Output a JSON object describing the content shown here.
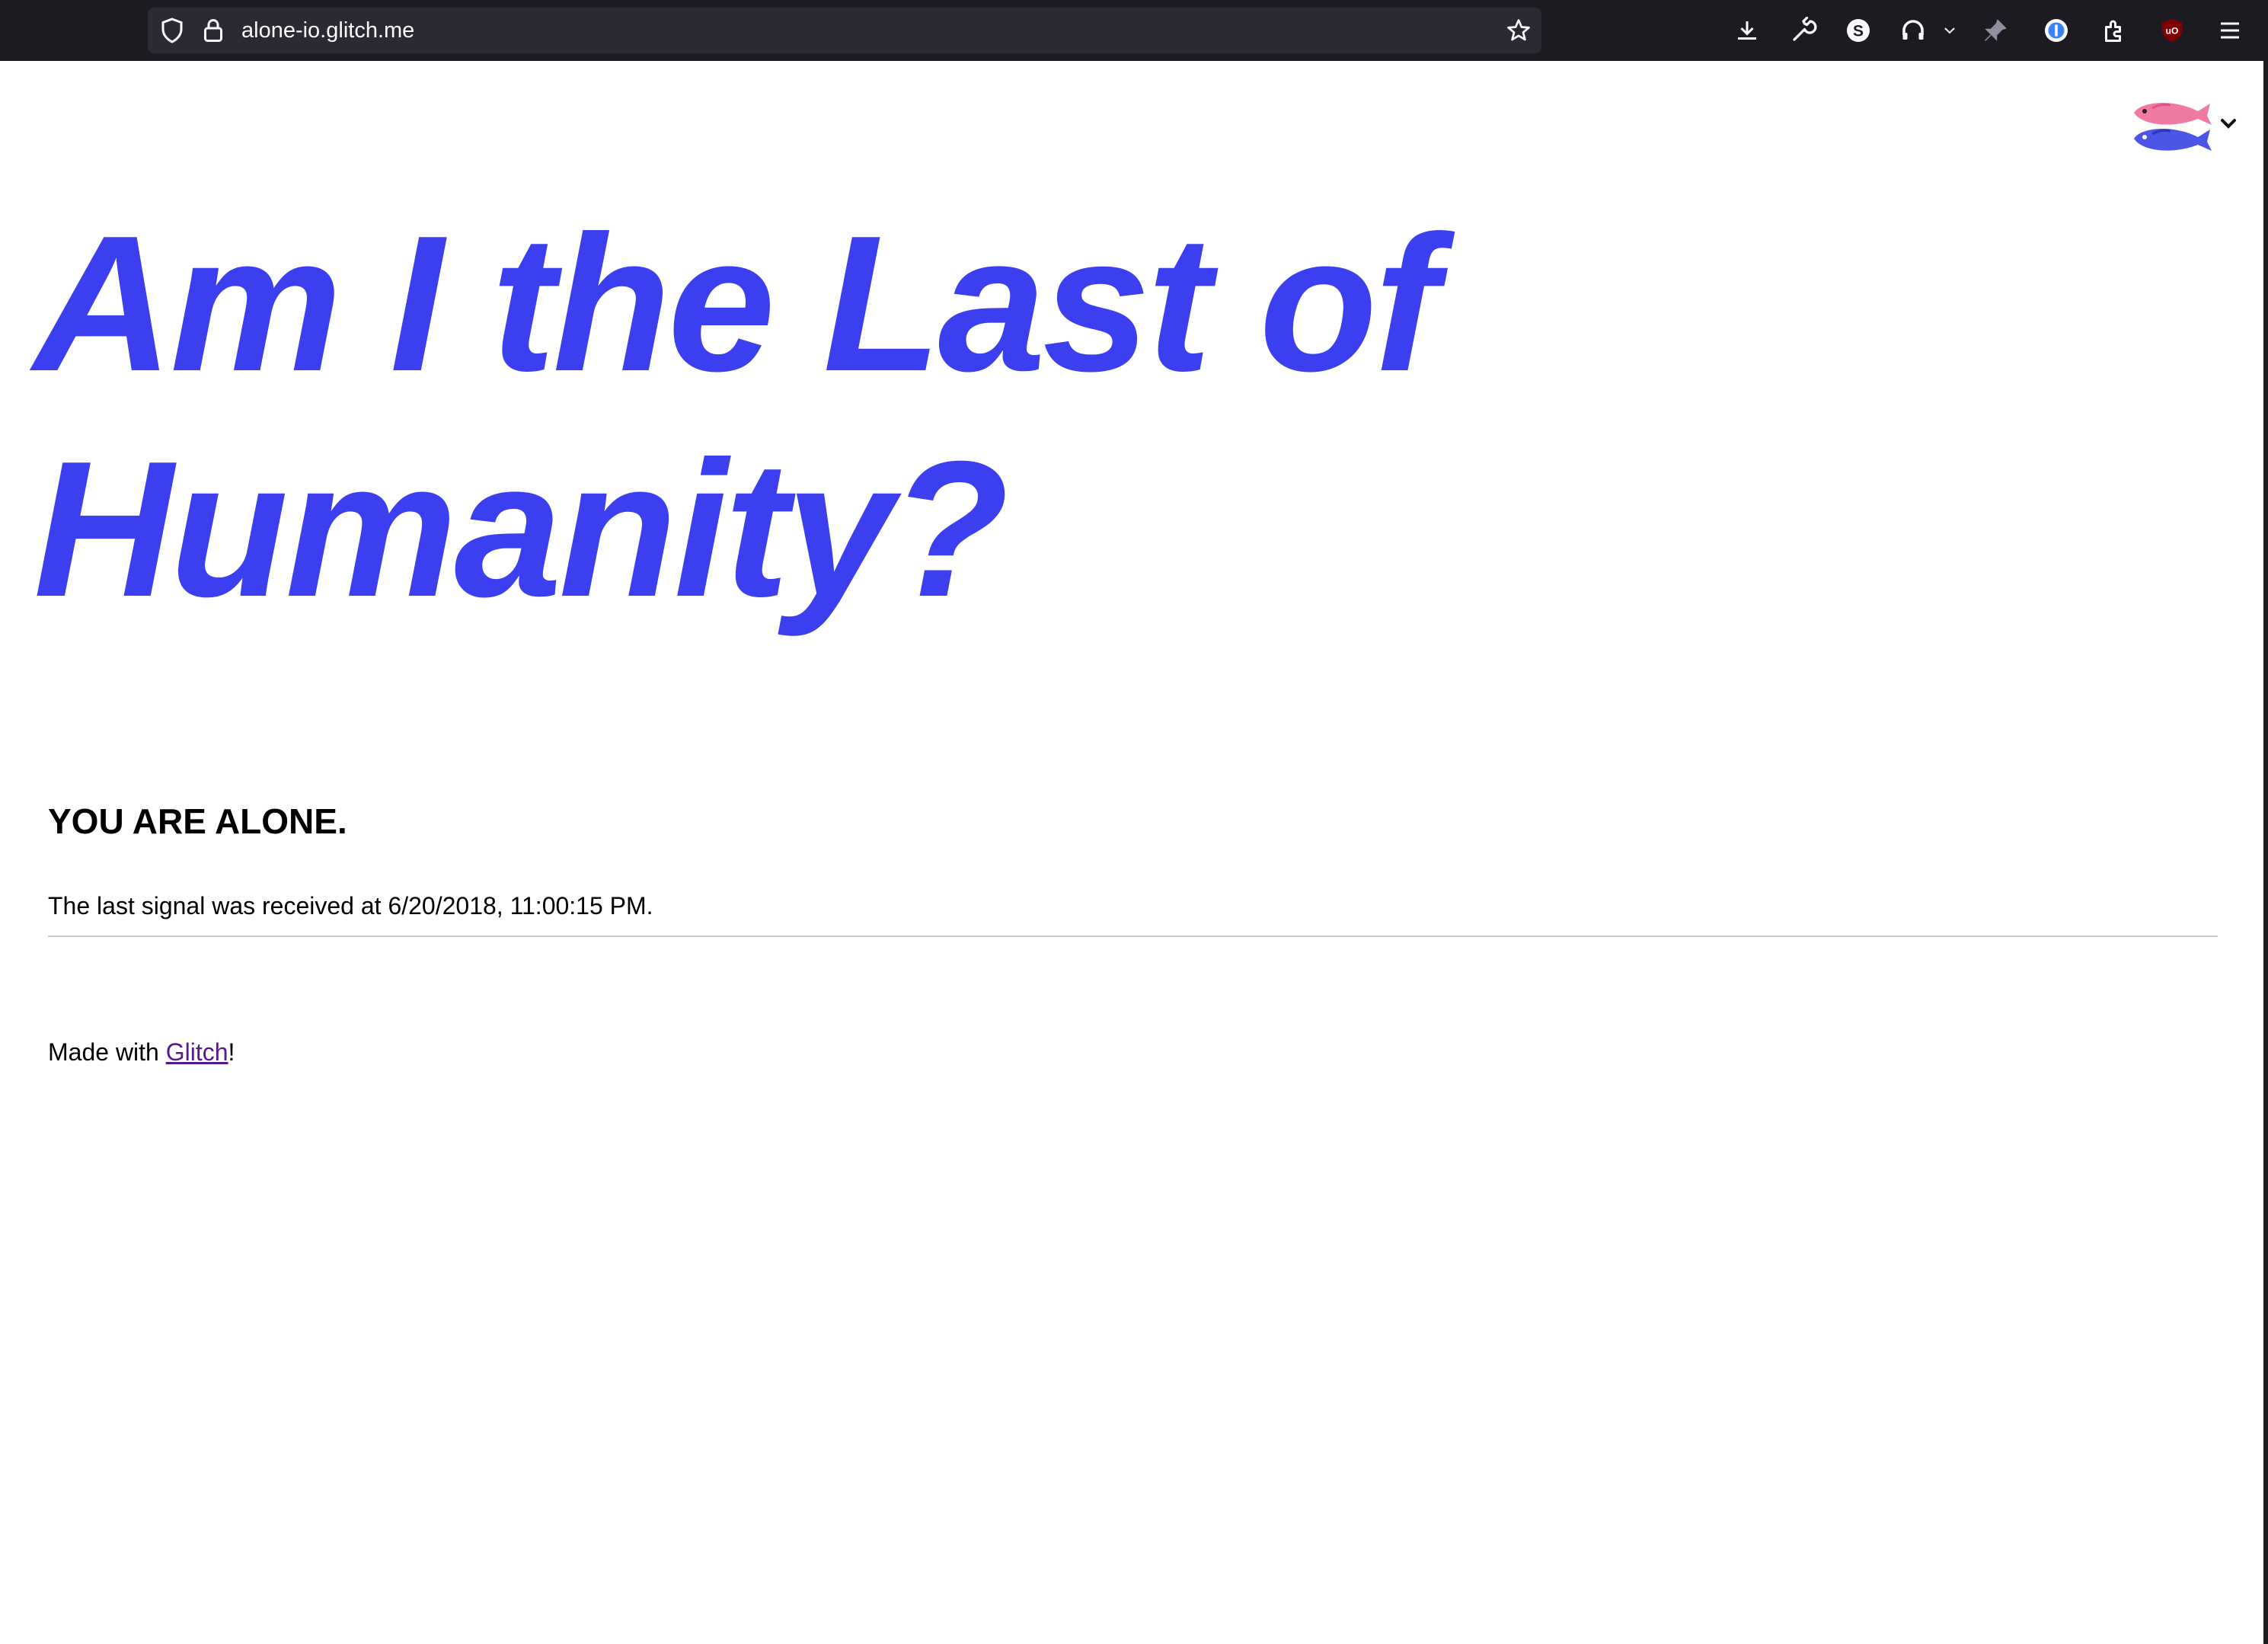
{
  "browser": {
    "url": "alone-io.glitch.me",
    "toolbar_icons": [
      "shield-icon",
      "lock-icon",
      "bookmark-star-icon",
      "download-icon",
      "wrench-icon",
      "s-extension-icon",
      "headphones-icon",
      "chevron-down-icon",
      "pin-icon",
      "password-manager-icon",
      "extensions-icon",
      "ublock-icon",
      "menu-icon"
    ]
  },
  "page": {
    "title": "Am I the Last of Humanity?",
    "status_heading": "YOU ARE ALONE.",
    "signal_text": "The last signal was received at 6/20/2018, 11:00:15 PM.",
    "footer": {
      "prefix": "Made with ",
      "link_label": "Glitch",
      "suffix": "!"
    },
    "badge_icon": "glitch-fish-icon"
  },
  "colors": {
    "title": "#3b3ff0",
    "link": "#551a8b",
    "toolbar": "#1c1b22",
    "url_bar": "#2b2a33"
  }
}
